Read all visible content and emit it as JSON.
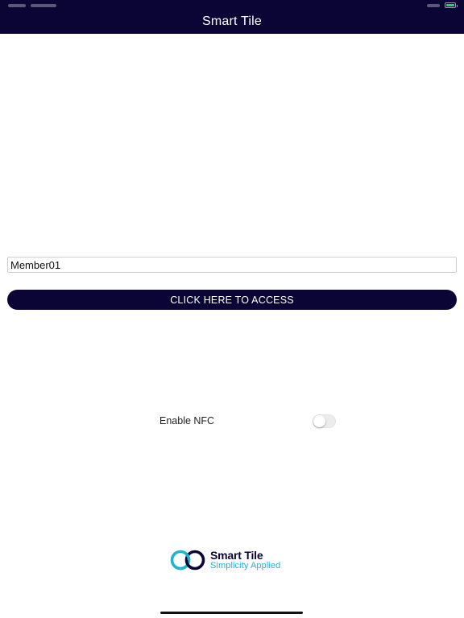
{
  "nav": {
    "title": "Smart Tile"
  },
  "form": {
    "member_value": "Member01",
    "access_label": "CLICK HERE TO ACCESS"
  },
  "nfc": {
    "label": "Enable NFC",
    "enabled": false
  },
  "brand": {
    "name": "Smart Tile",
    "tagline": "Simplicity Applied"
  },
  "colors": {
    "primary": "#0b0535",
    "accent": "#1fb3d2",
    "battery": "#2fd158"
  },
  "icons": {
    "battery": "battery-icon",
    "logo": "smart-tile-logo-icon"
  }
}
